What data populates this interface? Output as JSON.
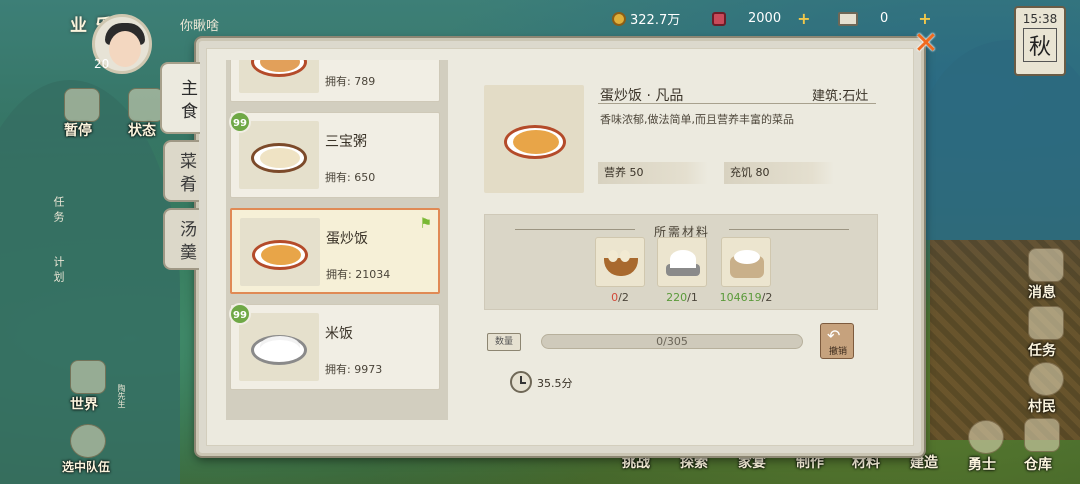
{
  "top": {
    "player_name": "你瞅啥",
    "level": "20",
    "side_tag": "乐业",
    "currency": [
      {
        "value": "322.7万",
        "icon": "coin-icon"
      },
      {
        "value": "2000",
        "icon": "gem-icon"
      },
      {
        "value": "0",
        "icon": "ticket-icon"
      }
    ],
    "time": "15:38",
    "season": "秋"
  },
  "left_menu": {
    "pause": "暂停",
    "status": "状态",
    "task": "任务",
    "plan": "计划",
    "world": "世界",
    "team": "选中队伍",
    "team_tag": "陶先生"
  },
  "right_menu": {
    "message": "消息",
    "task": "任务",
    "villager": "村民",
    "warrior": "勇士",
    "warehouse": "仓库"
  },
  "bottom_menu": [
    "挑战",
    "探索",
    "家宴",
    "制作",
    "材料",
    "建造"
  ],
  "tabs": [
    {
      "label": "主食",
      "active": true
    },
    {
      "label": "菜肴",
      "active": false
    },
    {
      "label": "汤羹",
      "active": false
    }
  ],
  "recipes": [
    {
      "name": "",
      "owned_label": "拥有: 789",
      "badge": "",
      "fill": "#e2a05a"
    },
    {
      "name": "三宝粥",
      "owned_label": "拥有: 650",
      "badge": "99",
      "fill": "#efe3c4"
    },
    {
      "name": "蛋炒饭",
      "owned_label": "拥有: 21034",
      "badge": "",
      "fill": "#e8a548",
      "selected": true
    },
    {
      "name": "米饭",
      "owned_label": "拥有: 9973",
      "badge": "99",
      "fill": "#ffffff"
    }
  ],
  "detail": {
    "title": "蛋炒饭 · 凡品",
    "building": "建筑:石灶",
    "description": "香味浓郁,做法简单,而且营养丰富的菜品",
    "nutrition_label": "营养 50",
    "satiety_label": "充饥 80",
    "materials_header": "所需材料",
    "materials": [
      {
        "icon": "egg-basket-icon",
        "have": "0",
        "need": "/2",
        "enough": false
      },
      {
        "icon": "salt-icon",
        "have": "220",
        "need": "/1",
        "enough": true
      },
      {
        "icon": "rice-icon",
        "have": "104619",
        "need": "/2",
        "enough": true
      }
    ],
    "progress_text": "0/305",
    "progress": 0,
    "qty_button": "数量",
    "undo_label": "撤销",
    "time_cost": "35.5分"
  },
  "colors": {
    "accent": "#e08a55",
    "close": "#f06a1e",
    "green_ok": "#5a9a3a",
    "red_lack": "#d24b3a"
  }
}
